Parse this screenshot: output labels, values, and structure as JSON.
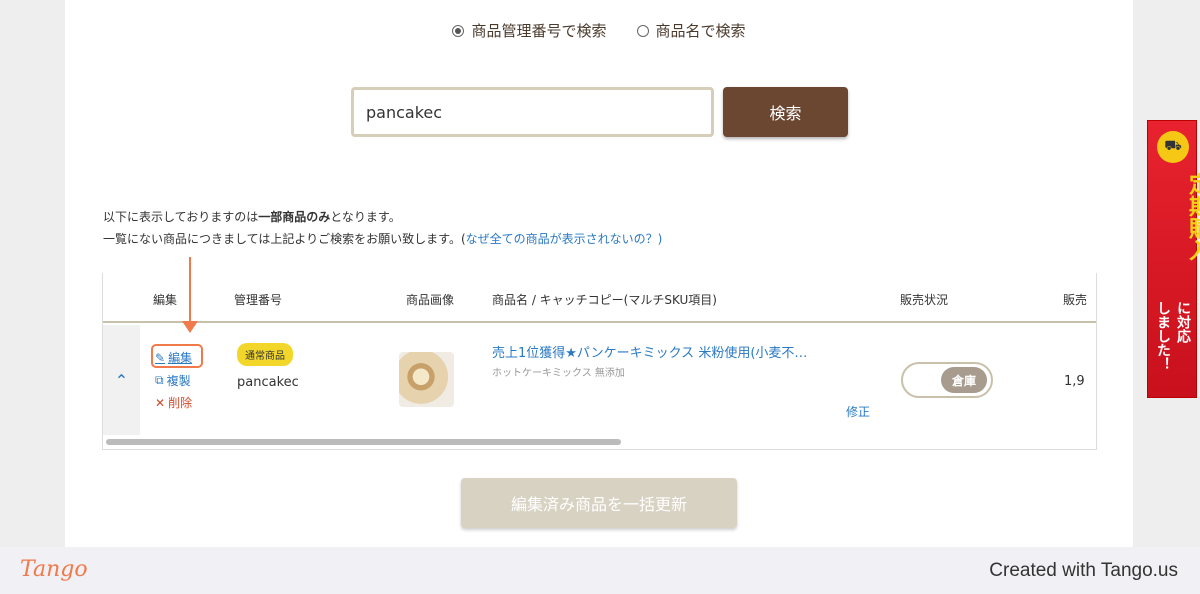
{
  "search": {
    "radio_options": [
      {
        "label": "商品管理番号で検索",
        "selected": true
      },
      {
        "label": "商品名で検索",
        "selected": false
      }
    ],
    "input_value": "pancakec",
    "button_label": "検索"
  },
  "notice": {
    "line1_pre": "以下に表示しておりますのは",
    "line1_bold": "一部商品のみ",
    "line1_post": "となります。",
    "line2_pre": "一覧にない商品につきましては上記よりご検索をお願い致します。(",
    "line2_link": "なぜ全ての商品が表示されないの？",
    "line2_post": ")"
  },
  "table": {
    "headers": {
      "edit": "編集",
      "code": "管理番号",
      "image": "商品画像",
      "name": "商品名 / キャッチコピー(マルチSKU項目)",
      "status": "販売状況",
      "price": "販売"
    },
    "row": {
      "actions": {
        "edit": "編集",
        "copy": "複製",
        "delete": "削除"
      },
      "badge": "通常商品",
      "code": "pancakec",
      "name": "売上1位獲得★パンケーキミックス 米粉使用(小麦不…",
      "catchcopy": "ホットケーキミックス 無添加",
      "fix_label": "修正",
      "status_toggle": "倉庫",
      "price_partial": "1,9"
    }
  },
  "bulk_update_label": "編集済み商品を一括更新",
  "banner": {
    "main_text": "定期購入",
    "sub_text_1": "に対応",
    "sub_text_2": "しました！"
  },
  "footer": {
    "logo": "Tango",
    "created": "Created with Tango.us"
  },
  "colors": {
    "brown": "#6b4731",
    "link": "#2a79c3",
    "highlight": "#f07a49",
    "badge": "#f2d72a"
  }
}
